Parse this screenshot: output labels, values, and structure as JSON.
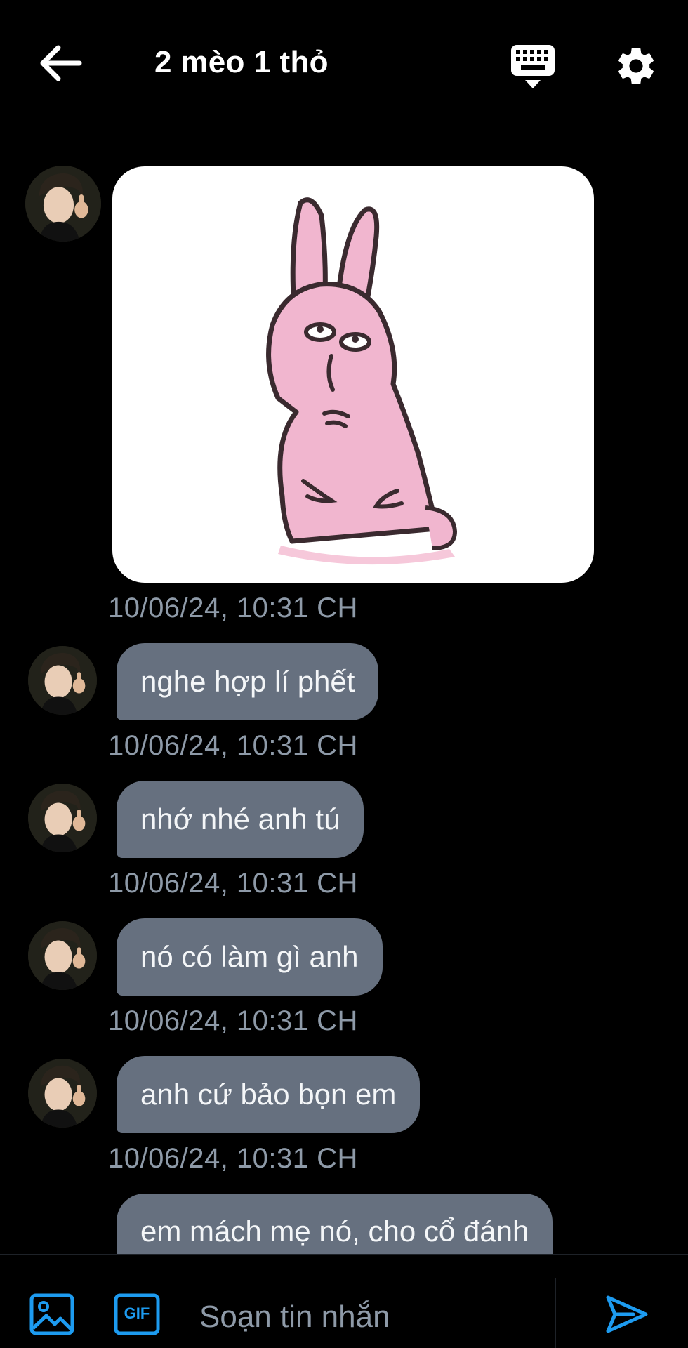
{
  "header": {
    "title": "2 mèo 1 thỏ",
    "back_icon": "arrow-left-icon",
    "keyboard_icon": "keyboard-icon",
    "settings_icon": "gear-icon"
  },
  "messages": [
    {
      "type": "sticker",
      "sticker": "pink-rabbit-sticker",
      "time": "10/06/24, 10:31 CH"
    },
    {
      "type": "text",
      "text": "nghe hợp lí phết",
      "time": "10/06/24, 10:31 CH"
    },
    {
      "type": "text",
      "text": "nhớ nhé anh tú",
      "time": "10/06/24, 10:31 CH"
    },
    {
      "type": "text",
      "text": "nó có làm gì anh",
      "time": "10/06/24, 10:31 CH"
    },
    {
      "type": "text",
      "text": "anh cứ bảo bọn em",
      "time": "10/06/24, 10:31 CH"
    },
    {
      "type": "text",
      "text": "em mách mẹ nó, cho cổ đánh"
    }
  ],
  "composer": {
    "placeholder": "Soạn tin nhắn",
    "gif_label": "GIF"
  },
  "colors": {
    "accent": "#1d9bf0",
    "bubble": "#66707f",
    "timestamp": "#8e9aa8",
    "background": "#000000"
  }
}
